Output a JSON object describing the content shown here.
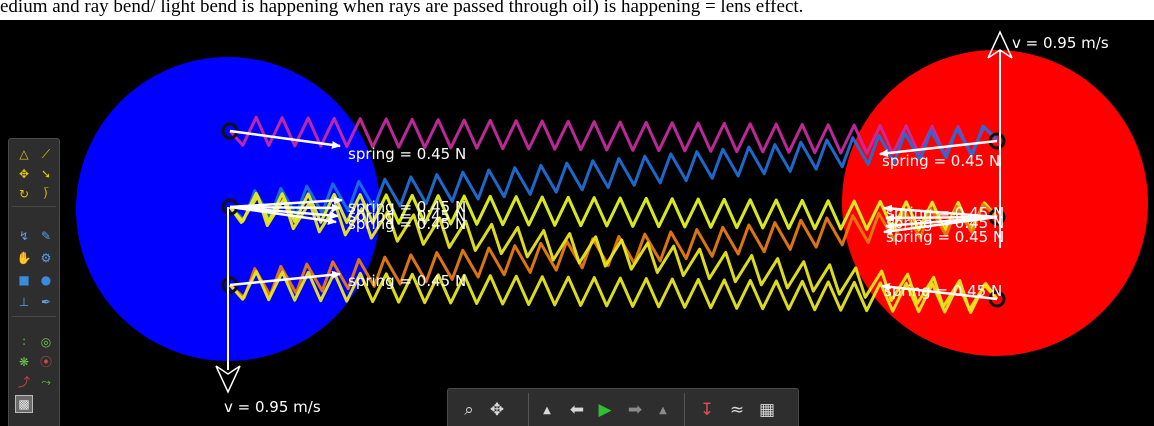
{
  "caption": "edium and ray bend/ light bend is happening when rays are passed through oil) is happening = lens effect.",
  "scene": {
    "velocity_top_label": "v = 0.95 m/s",
    "velocity_bottom_label": "v = 0.95 m/s",
    "spring_label": "spring = 0.45 N",
    "left_body_color": "#0000ff",
    "right_body_color": "#ff0000",
    "spring_colors": [
      "#c72aa0",
      "#1f6fd6",
      "#22d01c",
      "#e8e81e",
      "#e87a10"
    ]
  },
  "palette": {
    "icons": [
      "polygon-tool-icon",
      "line-tool-icon",
      "move-tool-icon",
      "pointer-tool-icon",
      "rotate-tool-icon",
      "scale-tool-icon",
      "spring-tool-icon",
      "pen-tool-icon",
      "hand-tool-icon",
      "gear-tool-icon",
      "box-tool-icon",
      "circle-tool-icon",
      "fixate-tool-icon",
      "knife-tool-icon",
      "tracer-tool-icon",
      "axle-tool-icon",
      "thruster-tool-icon",
      "laser-tool-icon",
      "chain-tool-icon",
      "hinge-tool-icon",
      "texture-tool-icon"
    ]
  },
  "toolbar": {
    "icons": [
      "zoom-icon",
      "pan-icon",
      "speed-down-icon",
      "undo-icon",
      "play-icon",
      "redo-icon",
      "speed-up-icon",
      "gravity-icon",
      "air-icon",
      "grid-icon"
    ]
  }
}
